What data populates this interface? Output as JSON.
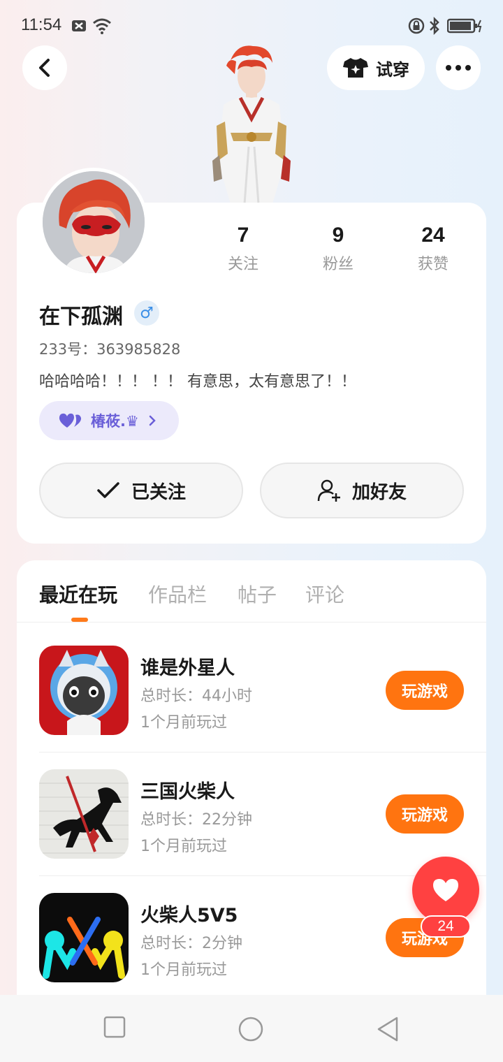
{
  "status_bar": {
    "time": "11:54"
  },
  "header": {
    "try_on_label": "试穿"
  },
  "profile": {
    "stats": [
      {
        "value": "7",
        "label": "关注"
      },
      {
        "value": "9",
        "label": "粉丝"
      },
      {
        "value": "24",
        "label": "获赞"
      }
    ],
    "username": "在下孤渊",
    "gender_symbol": "♂",
    "user_id": "233号：363985828",
    "bio": "哈哈哈哈！！！ ！！ 有意思，太有意思了！！",
    "club_name": "椿莜.♛",
    "follow_label": "已关注",
    "add_friend_label": "加好友"
  },
  "tabs": [
    {
      "label": "最近在玩",
      "active": true
    },
    {
      "label": "作品栏",
      "active": false
    },
    {
      "label": "帖子",
      "active": false
    },
    {
      "label": "评论",
      "active": false
    }
  ],
  "games": [
    {
      "name": "谁是外星人",
      "duration": "总时长：44小时",
      "last_played": "1个月前玩过",
      "button": "玩游戏"
    },
    {
      "name": "三国火柴人",
      "duration": "总时长：22分钟",
      "last_played": "1个月前玩过",
      "button": "玩游戏"
    },
    {
      "name": "火柴人5V5",
      "duration": "总时长：2分钟",
      "last_played": "1个月前玩过",
      "button": "玩游戏"
    }
  ],
  "like_count": "24",
  "colors": {
    "accent": "#ff7410",
    "like": "#ff4141",
    "club": "#6a5fd8"
  }
}
